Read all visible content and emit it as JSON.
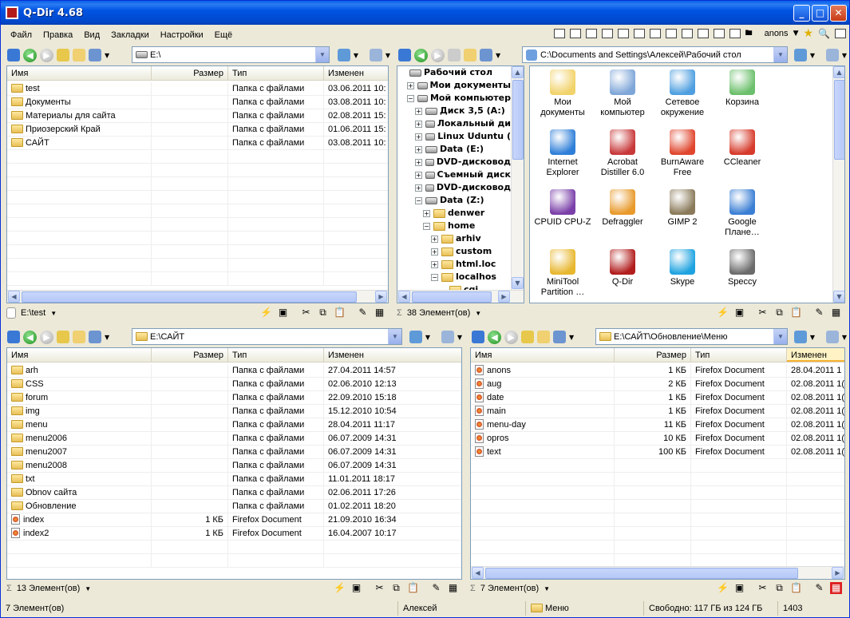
{
  "window": {
    "title": "Q-Dir 4.68"
  },
  "menu": [
    "Файл",
    "Правка",
    "Вид",
    "Закладки",
    "Настройки",
    "Ещё"
  ],
  "menu_user": "anons",
  "columns": {
    "name": "Имя",
    "size": "Размер",
    "type": "Тип",
    "modified": "Изменен"
  },
  "pane1": {
    "address": "E:\\",
    "rows": [
      {
        "name": "test",
        "size": "",
        "type": "Папка с файлами",
        "modified": "03.06.2011 10:"
      },
      {
        "name": "Документы",
        "size": "",
        "type": "Папка с файлами",
        "modified": "03.08.2011 10:"
      },
      {
        "name": "Материалы для сайта",
        "size": "",
        "type": "Папка с файлами",
        "modified": "02.08.2011 15:"
      },
      {
        "name": "Приозерский Край",
        "size": "",
        "type": "Папка с файлами",
        "modified": "01.06.2011 15:"
      },
      {
        "name": "САЙТ",
        "size": "",
        "type": "Папка с файлами",
        "modified": "03.08.2011 10:"
      }
    ],
    "status": "E:\\test"
  },
  "pane2": {
    "address": "C:\\Documents and Settings\\Алексей\\Рабочий стол",
    "tree": [
      {
        "label": "Рабочий стол",
        "level": 0,
        "toggle": ""
      },
      {
        "label": "Мои документы",
        "level": 1,
        "toggle": "+"
      },
      {
        "label": "Мой компьютер",
        "level": 1,
        "toggle": "−"
      },
      {
        "label": "Диск 3,5 (A:)",
        "level": 2,
        "toggle": "+"
      },
      {
        "label": "Локальный ди",
        "level": 2,
        "toggle": "+"
      },
      {
        "label": "Linux Udunt​u (",
        "level": 2,
        "toggle": "+"
      },
      {
        "label": "Data (E:)",
        "level": 2,
        "toggle": "+"
      },
      {
        "label": "DVD-дисковод",
        "level": 2,
        "toggle": "+"
      },
      {
        "label": "Съемный диск",
        "level": 2,
        "toggle": "+"
      },
      {
        "label": "DVD-дисковод",
        "level": 2,
        "toggle": "+"
      },
      {
        "label": "Data (Z:)",
        "level": 2,
        "toggle": "−"
      },
      {
        "label": "denwer",
        "level": 3,
        "toggle": "+"
      },
      {
        "label": "home",
        "level": 3,
        "toggle": "−"
      },
      {
        "label": "arhiv",
        "level": 4,
        "toggle": "+"
      },
      {
        "label": "custom",
        "level": 4,
        "toggle": "+"
      },
      {
        "label": "html.loc",
        "level": 4,
        "toggle": "+"
      },
      {
        "label": "localhos",
        "level": 4,
        "toggle": "−"
      },
      {
        "label": "cgi",
        "level": 5,
        "toggle": ""
      }
    ],
    "icons": [
      {
        "label": "Мои документы",
        "color": "#f2d36b"
      },
      {
        "label": "Мой компьютер",
        "color": "#7fa6d8"
      },
      {
        "label": "Сетевое окружение",
        "color": "#4f9fe0"
      },
      {
        "label": "Корзина",
        "color": "#6cbf6c"
      },
      {
        "label": "Internet Explorer",
        "color": "#2f7fd8"
      },
      {
        "label": "Acrobat Distiller 6.0",
        "color": "#c8393a"
      },
      {
        "label": "BurnAware Free",
        "color": "#e0462e"
      },
      {
        "label": "CCleaner",
        "color": "#d63b2b"
      },
      {
        "label": "CPUID CPU-Z",
        "color": "#7a3fa8"
      },
      {
        "label": "Defraggler",
        "color": "#e89a2c"
      },
      {
        "label": "GIMP 2",
        "color": "#8a7a5a"
      },
      {
        "label": "Google Плане…",
        "color": "#3b7fd4"
      },
      {
        "label": "MiniTool Partition …",
        "color": "#e8b730"
      },
      {
        "label": "Q-Dir",
        "color": "#b21d1d"
      },
      {
        "label": "Skype",
        "color": "#1fa3e0"
      },
      {
        "label": "Speccy",
        "color": "#6b6b6b"
      }
    ],
    "status": "38 Элемент(ов)"
  },
  "pane3": {
    "address": "E:\\САЙТ",
    "rows": [
      {
        "name": "arh",
        "size": "",
        "type": "Папка с файлами",
        "modified": "27.04.2011 14:57",
        "kind": "folder"
      },
      {
        "name": "CSS",
        "size": "",
        "type": "Папка с файлами",
        "modified": "02.06.2010 12:13",
        "kind": "folder"
      },
      {
        "name": "forum",
        "size": "",
        "type": "Папка с файлами",
        "modified": "22.09.2010 15:18",
        "kind": "folder"
      },
      {
        "name": "img",
        "size": "",
        "type": "Папка с файлами",
        "modified": "15.12.2010 10:54",
        "kind": "folder"
      },
      {
        "name": "menu",
        "size": "",
        "type": "Папка с файлами",
        "modified": "28.04.2011 11:17",
        "kind": "folder"
      },
      {
        "name": "menu2006",
        "size": "",
        "type": "Папка с файлами",
        "modified": "06.07.2009 14:31",
        "kind": "folder"
      },
      {
        "name": "menu2007",
        "size": "",
        "type": "Папка с файлами",
        "modified": "06.07.2009 14:31",
        "kind": "folder"
      },
      {
        "name": "menu2008",
        "size": "",
        "type": "Папка с файлами",
        "modified": "06.07.2009 14:31",
        "kind": "folder"
      },
      {
        "name": "txt",
        "size": "",
        "type": "Папка с файлами",
        "modified": "11.01.2011 18:17",
        "kind": "folder"
      },
      {
        "name": "Obnov сайта",
        "size": "",
        "type": "Папка с файлами",
        "modified": "02.06.2011 17:26",
        "kind": "folder"
      },
      {
        "name": "Обновление",
        "size": "",
        "type": "Папка с файлами",
        "modified": "01.02.2011 18:20",
        "kind": "folder"
      },
      {
        "name": "index",
        "size": "1 КБ",
        "type": "Firefox Document",
        "modified": "21.09.2010 16:34",
        "kind": "doc"
      },
      {
        "name": "index2",
        "size": "1 КБ",
        "type": "Firefox Document",
        "modified": "16.04.2007 10:17",
        "kind": "doc"
      }
    ],
    "status": "13 Элемент(ов)"
  },
  "pane4": {
    "address": "E:\\САЙТ\\Обновление\\Меню",
    "rows": [
      {
        "name": "anons",
        "size": "1 КБ",
        "type": "Firefox Document",
        "modified": "28.04.2011 1"
      },
      {
        "name": "aug",
        "size": "2 КБ",
        "type": "Firefox Document",
        "modified": "02.08.2011 1("
      },
      {
        "name": "date",
        "size": "1 КБ",
        "type": "Firefox Document",
        "modified": "02.08.2011 1("
      },
      {
        "name": "main",
        "size": "1 КБ",
        "type": "Firefox Document",
        "modified": "02.08.2011 1("
      },
      {
        "name": "menu-day",
        "size": "11 КБ",
        "type": "Firefox Document",
        "modified": "02.08.2011 1("
      },
      {
        "name": "opros",
        "size": "10 КБ",
        "type": "Firefox Document",
        "modified": "02.08.2011 1("
      },
      {
        "name": "text",
        "size": "100 КБ",
        "type": "Firefox Document",
        "modified": "02.08.2011 1("
      }
    ],
    "status": "7 Элемент(ов)"
  },
  "bottom": {
    "items": "7 Элемент(ов)",
    "user": "Алексей",
    "folder": "Меню",
    "free": "Свободно: 117 ГБ из 124 ГБ",
    "num": "1403"
  }
}
